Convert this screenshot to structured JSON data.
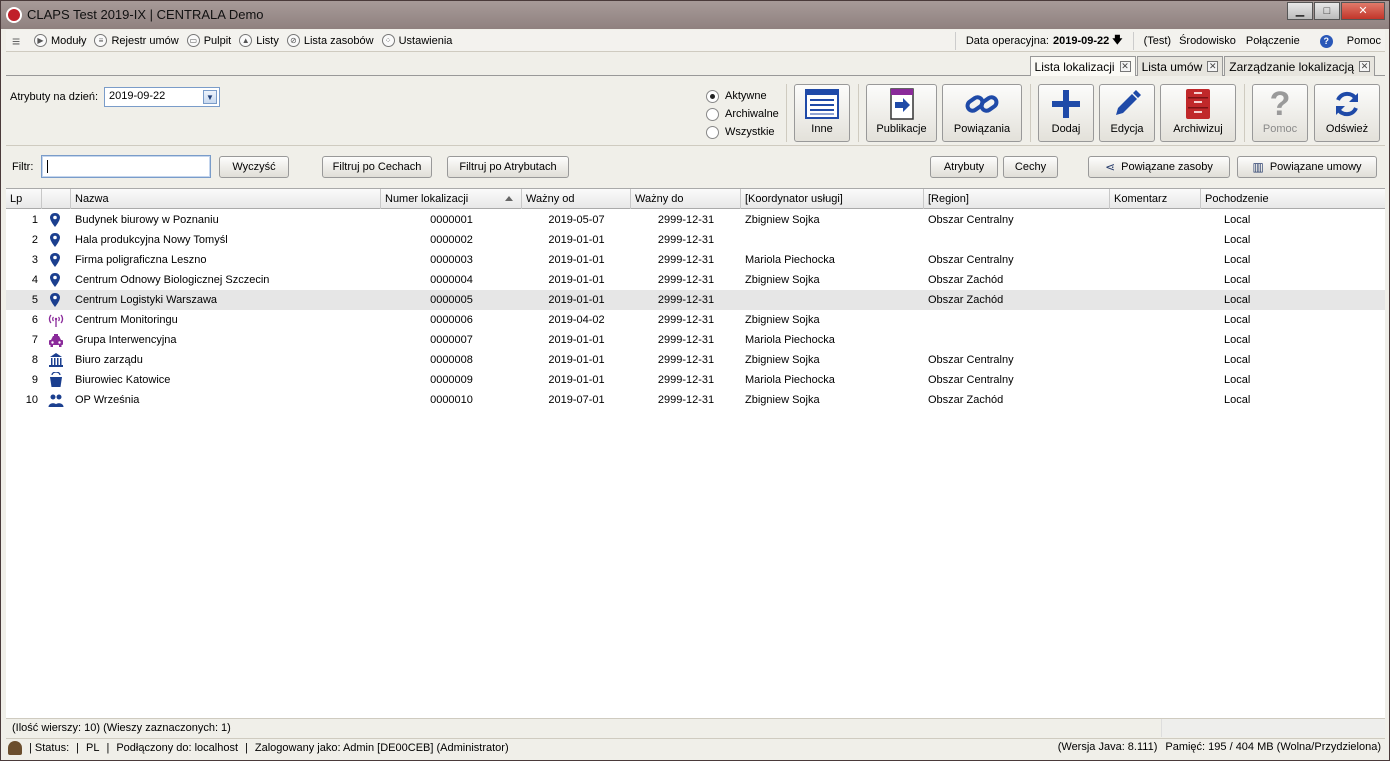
{
  "window": {
    "title": "CLAPS Test 2019-IX | CENTRALA Demo",
    "min": "▁",
    "max": "□",
    "close": "✕"
  },
  "menu": {
    "items": [
      "Moduły",
      "Rejestr umów",
      "Pulpit",
      "Listy",
      "Lista zasobów",
      "Ustawienia"
    ],
    "date_label": "Data operacyjna:",
    "date_value": "2019-09-22",
    "date_arrow": "🡇",
    "env": "(Test)",
    "srodowisko": "Środowisko",
    "polaczenie": "Połączenie",
    "pomoc": "Pomoc"
  },
  "tabs": [
    {
      "label": "Lista lokalizacji",
      "active": true
    },
    {
      "label": "Lista umów",
      "active": false
    },
    {
      "label": "Zarządzanie lokalizacją",
      "active": false
    }
  ],
  "toolbar": {
    "attr_label": "Atrybuty na dzień:",
    "attr_date": "2019-09-22",
    "radios": [
      {
        "label": "Aktywne",
        "checked": true
      },
      {
        "label": "Archiwalne",
        "checked": false
      },
      {
        "label": "Wszystkie",
        "checked": false
      }
    ],
    "buttons": {
      "inne": "Inne",
      "publikacje": "Publikacje",
      "powiazania": "Powiązania",
      "dodaj": "Dodaj",
      "edycja": "Edycja",
      "archiwizuj": "Archiwizuj",
      "pomoc": "Pomoc",
      "odswiez": "Odśwież"
    }
  },
  "filter": {
    "label": "Filtr:",
    "value": "",
    "clear": "Wyczyść",
    "by_features": "Filtruj po Cechach",
    "by_attributes": "Filtruj po Atrybutach",
    "atrybuty": "Atrybuty",
    "cechy": "Cechy",
    "linked_resources": "Powiązane zasoby",
    "linked_contracts": "Powiązane umowy"
  },
  "table": {
    "headers": [
      "Lp",
      "",
      "Nazwa",
      "Numer lokalizacji",
      "Ważny od",
      "Ważny do",
      "[Koordynator usługi]",
      "[Region]",
      "Komentarz",
      "Pochodzenie"
    ],
    "rows": [
      {
        "lp": "1",
        "icon": "map-pin-icon",
        "nazwa": "Budynek biurowy w Poznaniu",
        "numer": "0000001",
        "od": "2019-05-07",
        "do": "2999-12-31",
        "koord": "Zbigniew Sojka",
        "region": "Obszar Centralny",
        "koment": "",
        "poch": "Local"
      },
      {
        "lp": "2",
        "icon": "map-pin-icon",
        "nazwa": "Hala produkcyjna Nowy Tomyśl",
        "numer": "0000002",
        "od": "2019-01-01",
        "do": "2999-12-31",
        "koord": "",
        "region": "",
        "koment": "",
        "poch": "Local"
      },
      {
        "lp": "3",
        "icon": "map-pin-icon",
        "nazwa": "Firma poligraficzna Leszno",
        "numer": "0000003",
        "od": "2019-01-01",
        "do": "2999-12-31",
        "koord": "Mariola Piechocka",
        "region": "Obszar Centralny",
        "koment": "",
        "poch": "Local"
      },
      {
        "lp": "4",
        "icon": "map-pin-icon",
        "nazwa": "Centrum Odnowy Biologicznej Szczecin",
        "numer": "0000004",
        "od": "2019-01-01",
        "do": "2999-12-31",
        "koord": "Zbigniew Sojka",
        "region": "Obszar Zachód",
        "koment": "",
        "poch": "Local"
      },
      {
        "lp": "5",
        "icon": "map-pin-icon",
        "nazwa": "Centrum Logistyki Warszawa",
        "numer": "0000005",
        "od": "2019-01-01",
        "do": "2999-12-31",
        "koord": "",
        "region": "Obszar Zachód",
        "koment": "",
        "poch": "Local"
      },
      {
        "lp": "6",
        "icon": "antenna-icon",
        "nazwa": "Centrum Monitoringu",
        "numer": "0000006",
        "od": "2019-04-02",
        "do": "2999-12-31",
        "koord": "Zbigniew Sojka",
        "region": "",
        "koment": "",
        "poch": "Local"
      },
      {
        "lp": "7",
        "icon": "car-icon",
        "nazwa": "Grupa Interwencyjna",
        "numer": "0000007",
        "od": "2019-01-01",
        "do": "2999-12-31",
        "koord": "Mariola Piechocka",
        "region": "",
        "koment": "",
        "poch": "Local"
      },
      {
        "lp": "8",
        "icon": "building-columns-icon",
        "nazwa": "Biuro zarządu",
        "numer": "0000008",
        "od": "2019-01-01",
        "do": "2999-12-31",
        "koord": "Zbigniew Sojka",
        "region": "Obszar Centralny",
        "koment": "",
        "poch": "Local"
      },
      {
        "lp": "9",
        "icon": "bucket-icon",
        "nazwa": "Biurowiec Katowice",
        "numer": "0000009",
        "od": "2019-01-01",
        "do": "2999-12-31",
        "koord": "Mariola Piechocka",
        "region": "Obszar Centralny",
        "koment": "",
        "poch": "Local"
      },
      {
        "lp": "10",
        "icon": "people-icon",
        "nazwa": "OP Września",
        "numer": "0000010",
        "od": "2019-07-01",
        "do": "2999-12-31",
        "koord": "Zbigniew Sojka",
        "region": "Obszar Zachód",
        "koment": "",
        "poch": "Local"
      }
    ],
    "selected_row": 5
  },
  "counts": "(Ilość wierszy: 10)  (Wieszy zaznaczonych: 1)",
  "status": {
    "status": "| Status:",
    "lang": "PL",
    "connected": "Podłączony do: localhost",
    "user": "Zalogowany jako: Admin [DE00CEB] (Administrator)",
    "java": "(Wersja Java: 8.111)",
    "memory": "Pamięć: 195 / 404 MB (Wolna/Przydzielona)",
    "pipe": "|"
  },
  "colors": {
    "accent_blue": "#1f4aa8",
    "selected_row": "#e6e6e6",
    "archive_red": "#c0282a",
    "pin_blue": "#1b3f8f"
  }
}
